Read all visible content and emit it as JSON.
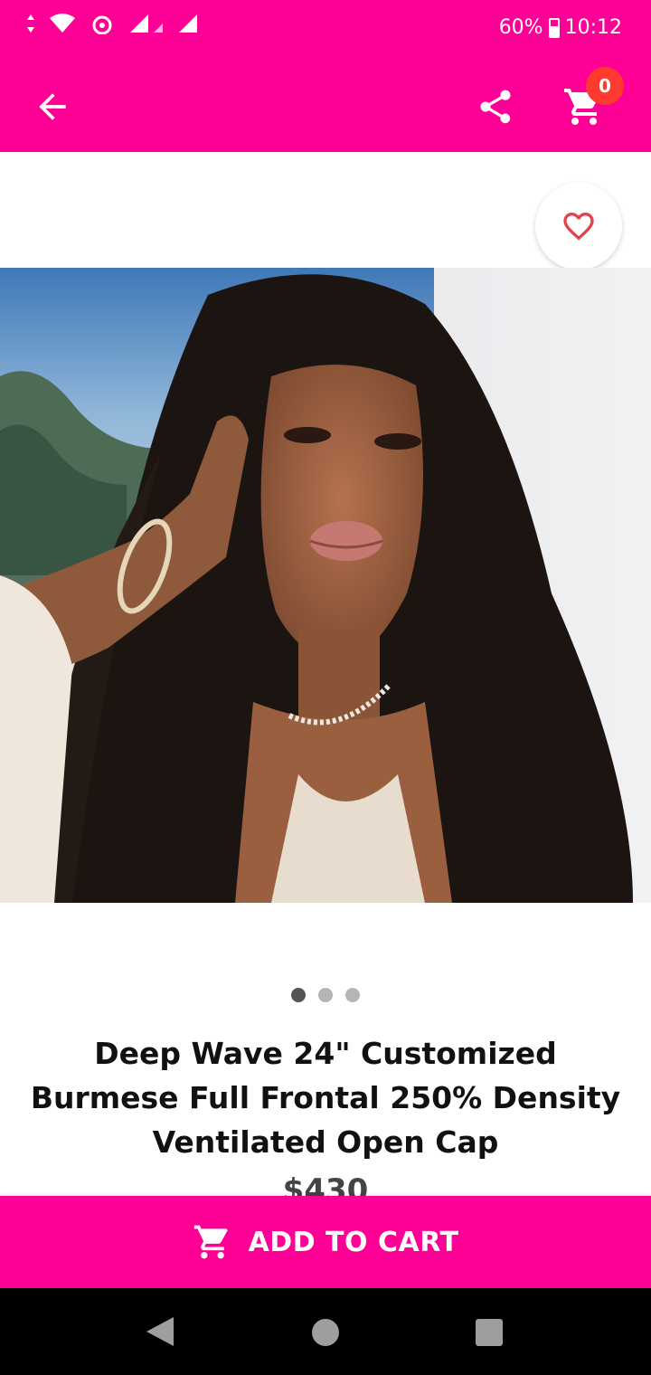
{
  "status_bar": {
    "battery": "60%",
    "time": "10:12"
  },
  "app_bar": {
    "cart_count": "0"
  },
  "carousel": {
    "image_count": 3,
    "active_index": 0
  },
  "product": {
    "title": "Deep Wave 24\" Customized Burmese Full Frontal 250% Density Ventilated Open Cap",
    "price": "$430"
  },
  "actions": {
    "add_to_cart": "ADD TO CART"
  },
  "colors": {
    "brand_pink": "#FF0096",
    "badge_red": "#FF3B2F",
    "heart_red": "#E0454B"
  },
  "icons": [
    "wifi-icon",
    "signal-icon",
    "battery-icon",
    "back-arrow-icon",
    "share-icon",
    "cart-icon",
    "heart-icon",
    "nav-back-icon",
    "nav-home-icon",
    "nav-recent-icon"
  ]
}
